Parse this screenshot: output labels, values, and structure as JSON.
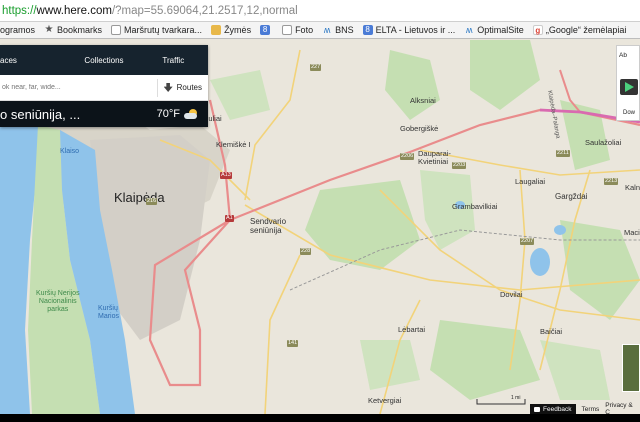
{
  "browser": {
    "url_scheme": "https://",
    "url_host": "www.here.com",
    "url_path": "/?map=55.69064,21.2517,12,normal",
    "bookmarks": [
      {
        "label": "ogramos",
        "icon": "page-icon"
      },
      {
        "label": "Bookmarks",
        "icon": "star-icon"
      },
      {
        "label": "Maršrutų tvarkara...",
        "icon": "page-icon"
      },
      {
        "label": "Žymės",
        "icon": "folder-icon"
      },
      {
        "label": "",
        "icon": "g-icon"
      },
      {
        "label": "Foto",
        "icon": "page-icon"
      },
      {
        "label": "BNS",
        "icon": "bird-icon"
      },
      {
        "label": "ELTA - Lietuvos ir ...",
        "icon": "g-icon"
      },
      {
        "label": "OptimalSite",
        "icon": "bird-icon"
      },
      {
        "label": "„Google“ žemėlapiai",
        "icon": "google-maps-icon"
      }
    ]
  },
  "panel": {
    "tabs": [
      "aces",
      "Collections",
      "Traffic"
    ],
    "search_placeholder": "ok near, far, wide...",
    "routes_label": "Routes",
    "place_name": "o seniūnija, ...",
    "temperature": "70°F",
    "weather_icon": "partly-cloudy-icon"
  },
  "map": {
    "labels": {
      "klaipeda": "Klaipėda",
      "sendvario": "Sendvario\nseniūnija",
      "alksniai": "Alksniai",
      "gobergiske": "Gobergiškė",
      "daupariai": "Dauparai-\nKvietiniai",
      "laugaliai": "Laugaliai",
      "sauzosiai": "Saulažoliai",
      "gargzdai": "Gargždai",
      "grambov": "Grambavilkiai",
      "dovilai": "Dovilai",
      "lebartai": "Lėbartai",
      "baiciai": "Baičiai",
      "ketvergiai": "Ketvergiai",
      "kalniai": "Kalni",
      "maciu": "Maciu",
      "klemiske": "Klemiškė I",
      "anduliai": "nduliai",
      "kairiai": "Klaiso",
      "kursiu": "Kuršių Nerijos\nNacionalinis\nparkas",
      "kursiu_marios": "Kuršių\nMarios",
      "kursiu2": "Kuršių Nerija",
      "highway_a13": "A13",
      "highway_a1": "A1",
      "road_141": "141",
      "road_227": "227",
      "road_228": "228",
      "road_216": "216",
      "road_2211": "2211",
      "road_2207": "2207",
      "road_2203": "2203",
      "road_2213": "2213",
      "road_2206": "2206"
    },
    "highway_vertical_label": "Klaipėda–Palanga"
  },
  "right_widget": {
    "label_top": "Ab",
    "label_bottom": "Dow"
  },
  "footer": {
    "scale": "1 mi",
    "feedback": "Feedback",
    "terms": "Terms",
    "privacy": "Privacy & C"
  },
  "colors": {
    "land": "#eae6dc",
    "water": "#8fc3ea",
    "park": "#c5dfb2",
    "urban": "#d7d3cc",
    "highway": "#e98c8c",
    "motorway": "#d96ab0",
    "panel_dark": "#16232e"
  }
}
